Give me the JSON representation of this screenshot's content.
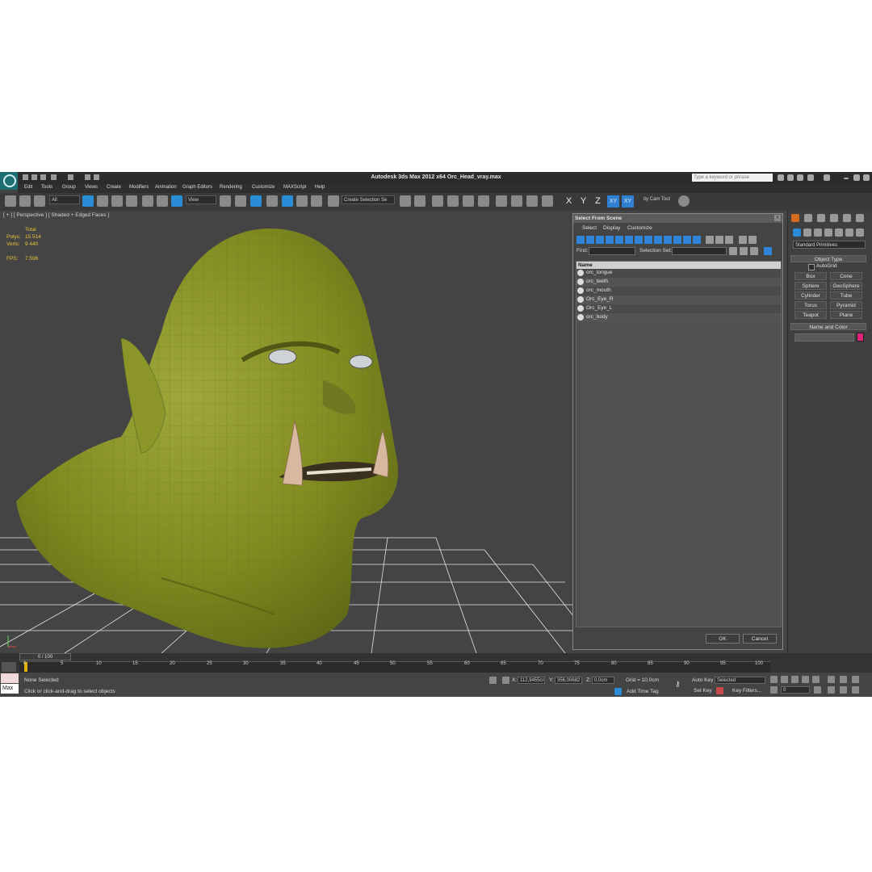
{
  "app": {
    "title": "Autodesk 3ds Max  2012 x64    Orc_Head_vray.max",
    "search_placeholder": "Type a keyword or phrase"
  },
  "menu": [
    "Edit",
    "Tools",
    "Group",
    "Views",
    "Create",
    "Modifiers",
    "Animation",
    "Graph Editors",
    "Rendering",
    "Customize",
    "MAXScript",
    "Help"
  ],
  "toolbar": {
    "filter_value": "All",
    "view_value": "View",
    "selection_set_value": "Create Selection Se",
    "axes": [
      "X",
      "Y",
      "Z",
      "XY",
      "XY"
    ],
    "tool_label": "ity Cam Tool"
  },
  "viewport": {
    "label": "[ + ] [ Perspective ] [ Shaded + Edged Faces ]",
    "stats": {
      "total_label": "Total",
      "polys_label": "Polys:",
      "polys_value": "15 514",
      "verts_label": "Verts:",
      "verts_value": "9 440",
      "fps_label": "FPS:",
      "fps_value": "7.596"
    }
  },
  "select_dialog": {
    "title": "Select From Scene",
    "menus": [
      "Select",
      "Display",
      "Customize"
    ],
    "find_label": "Find:",
    "selection_set_label": "Selection Set:",
    "column_header": "Name",
    "items": [
      "orc_tongue",
      "orc_teeth",
      "orc_mouth",
      "Orc_Eye_R",
      "Orc_Eye_L",
      "orc_body"
    ],
    "ok_label": "OK",
    "cancel_label": "Cancel"
  },
  "command_panel": {
    "category": "Standard Primitives",
    "object_type_title": "Object Type",
    "autogrid_label": "AutoGrid",
    "primitives": [
      "Box",
      "Cone",
      "Sphere",
      "GeoSphere",
      "Cylinder",
      "Tube",
      "Torus",
      "Pyramid",
      "Teapot",
      "Plane"
    ],
    "name_color_title": "Name and Color",
    "object_color": "#e0237a"
  },
  "timeline": {
    "slider_label": "0 / 100",
    "ticks": [
      "0",
      "5",
      "10",
      "15",
      "20",
      "25",
      "30",
      "35",
      "40",
      "45",
      "50",
      "55",
      "60",
      "65",
      "70",
      "75",
      "80",
      "85",
      "90",
      "95",
      "100"
    ]
  },
  "status": {
    "max_label": "Max",
    "selection": "None Selected",
    "prompt": "Click or click-and-drag to select objects",
    "x_label": "X:",
    "x_value": "112,9455cr",
    "y_label": "Y:",
    "y_value": "356,00682",
    "z_label": "Z:",
    "z_value": "0,0cm",
    "grid": "Grid = 10,0cm",
    "add_time_tag": "Add Time Tag",
    "auto_key": "Auto Key",
    "set_key": "Set Key",
    "key_mode": "Selected",
    "key_filters": "Key Filters...",
    "frame": "0"
  }
}
